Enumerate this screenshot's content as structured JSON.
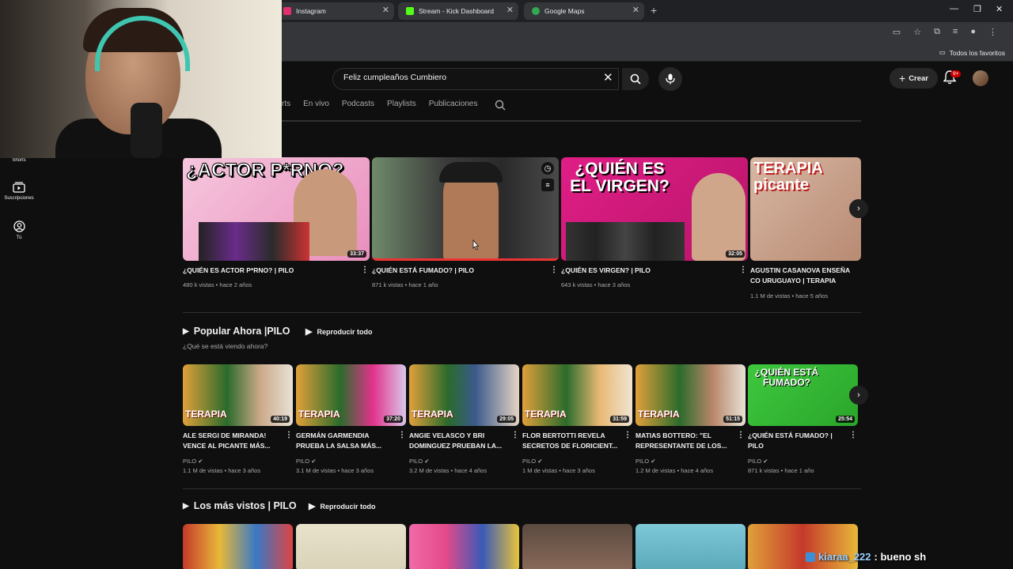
{
  "browser": {
    "tabs": [
      {
        "label": "Instagram",
        "color": "#e1306c"
      },
      {
        "label": "Stream - Kick Dashboard",
        "color": "#53fc18"
      },
      {
        "label": "Google Maps",
        "color": "#34a853"
      }
    ],
    "bookmarks_all": "Todos los favoritos"
  },
  "header": {
    "search_value": "Feliz cumpleaños Cumbiero",
    "create_label": "Crear",
    "notif_badge": "9+"
  },
  "channel_tabs": [
    "rts",
    "En vivo",
    "Podcasts",
    "Playlists",
    "Publicaciones"
  ],
  "sidebar": [
    {
      "label": "Shorts"
    },
    {
      "label": "Suscripciones"
    },
    {
      "label": "Tú"
    }
  ],
  "row1": [
    {
      "title": "¿QUIÉN ES ACTOR P*RNO? | PILO",
      "meta": "480 k vistas • hace 2 años",
      "duration": "33:37",
      "thumb_text": "¿ACTOR P*RNO?",
      "bg": "#f2b6d0"
    },
    {
      "title": "¿QUIÉN ESTÁ FUMADO? | PILO",
      "meta": "871 k vistas • hace 1 año",
      "duration": "",
      "thumb_text": "",
      "bg": "#5a6b5a"
    },
    {
      "title": "¿QUIÉN ES VIRGEN? | PILO",
      "meta": "643 k vistas • hace 3 años",
      "duration": "32:05",
      "thumb_text": "¿QUIÉN ES EL VIRGEN?",
      "bg": "#d6197a"
    },
    {
      "title": "AGUSTIN CASANOVA ENSEÑA CO URUGUAYO | TERAPIA PICANTE",
      "meta": "1.1 M de vistas • hace 5 años",
      "duration": "",
      "thumb_text": "TERAPIA picante",
      "bg": "#c9a48d"
    }
  ],
  "section2": {
    "title": "Popular Ahora |PILO",
    "play_all": "Reproducir todo",
    "subtitle": "¿Qué se está viendo ahora?"
  },
  "row2": [
    {
      "title1": "ALE SERGI DE MIRANDA!",
      "title2": "VENCE AL PICANTE MÁS...",
      "channel": "PILO",
      "meta": "1.1 M de vistas • hace 3 años",
      "duration": "40:19",
      "thumb_text": "TERAPIA"
    },
    {
      "title1": "GERMÁN GARMENDIA",
      "title2": "PRUEBA LA SALSA MÁS...",
      "channel": "PILO",
      "meta": "3.1 M de vistas • hace 3 años",
      "duration": "37:20",
      "thumb_text": "TERAPIA"
    },
    {
      "title1": "ANGIE VELASCO Y BRI",
      "title2": "DOMINGUEZ PRUEBAN LA...",
      "channel": "PILO",
      "meta": "3.2 M de vistas • hace 4 años",
      "duration": "29:05",
      "thumb_text": "TERAPIA"
    },
    {
      "title1": "FLOR BERTOTTI REVELA",
      "title2": "SECRETOS DE FLORICIENT...",
      "channel": "PILO",
      "meta": "1 M de vistas • hace 3 años",
      "duration": "31:59",
      "thumb_text": "TERAPIA"
    },
    {
      "title1": "MATIAS BOTTERO: \"EL",
      "title2": "REPRESENTANTE DE LOS...",
      "channel": "PILO",
      "meta": "1.2 M de vistas • hace 4 años",
      "duration": "51:15",
      "thumb_text": "TERAPIA"
    },
    {
      "title1": "¿QUIÉN ESTÁ FUMADO? |",
      "title2": "PILO",
      "channel": "PILO",
      "meta": "871 k vistas • hace 1 año",
      "duration": "25:54",
      "thumb_text": "¿QUIÉN ESTÁ FUMADO?"
    }
  ],
  "section3": {
    "title": "Los más vistos | PILO",
    "play_all": "Reproducir todo"
  },
  "chat": {
    "user": "kiaraa_222",
    "message": ": bueno sh"
  }
}
